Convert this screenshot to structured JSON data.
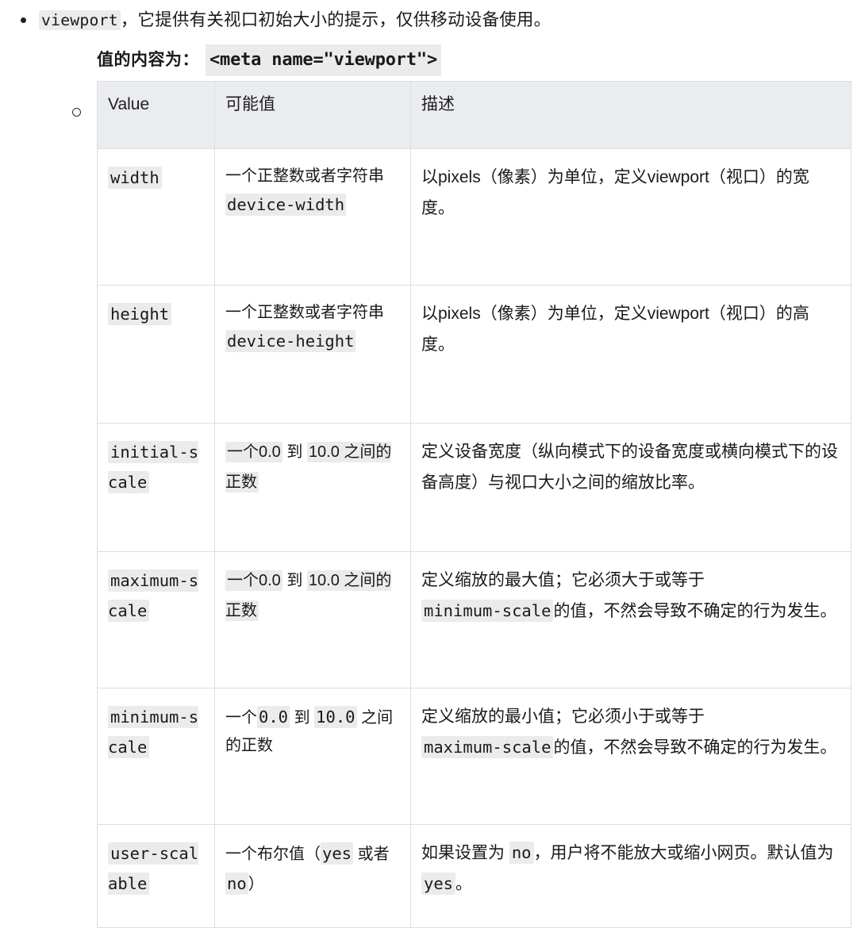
{
  "intro": {
    "bullet_code": "viewport",
    "bullet_text": "，它提供有关视口初始大小的提示，仅供移动设备使用。"
  },
  "value_line": {
    "label": "值的内容为：",
    "code": "<meta name=\"viewport\">"
  },
  "table": {
    "headers": [
      "Value",
      "可能值",
      "描述"
    ],
    "rows": [
      {
        "key": "width",
        "value_plain_1": "一个正整数或者字符串 ",
        "value_code_1": "device-width",
        "value_plain_2": "",
        "value_code_2": "",
        "value_plain_3": "",
        "desc_1": "以pixels（像素）为单位，定义viewport（视口）的宽度。",
        "desc_code": "",
        "desc_2": ""
      },
      {
        "key": "height",
        "value_plain_1": "一个正整数或者字符串 ",
        "value_code_1": "device-height",
        "value_plain_2": "",
        "value_code_2": "",
        "value_plain_3": "",
        "desc_1": "以pixels（像素）为单位，定义viewport（视口）的高度。",
        "desc_code": "",
        "desc_2": ""
      },
      {
        "key": "initial-scale",
        "value_plain_1": "",
        "value_code_1": "一个0.0",
        "value_plain_2": " 到 ",
        "value_code_2": "10.0 之间的正数",
        "value_plain_3": "",
        "desc_1": "定义设备宽度（纵向模式下的设备宽度或横向模式下的设备高度）与视口大小之间的缩放比率。",
        "desc_code": "",
        "desc_2": ""
      },
      {
        "key": "maximum-scale",
        "value_plain_1": "",
        "value_code_1": "一个0.0",
        "value_plain_2": " 到 ",
        "value_code_2": "10.0 之间的正数",
        "value_plain_3": "",
        "desc_1": "定义缩放的最大值；它必须大于或等于",
        "desc_code": "minimum-scale",
        "desc_2": "的值，不然会导致不确定的行为发生。"
      },
      {
        "key": "minimum-scale",
        "value_plain_1": "一个",
        "value_code_1": "0.0",
        "value_plain_2": " 到 ",
        "value_code_2": "10.0",
        "value_plain_3": " 之间的正数",
        "desc_1": "定义缩放的最小值；它必须小于或等于",
        "desc_code": "maximum-scale",
        "desc_2": "的值，不然会导致不确定的行为发生。"
      },
      {
        "key": "user-scalable",
        "value_plain_1": "一个布尔值（",
        "value_code_1": "yes",
        "value_plain_2": " 或者",
        "value_code_2": "no",
        "value_plain_3": "）",
        "desc_1": "如果设置为 ",
        "desc_code": "no",
        "desc_2": "，用户将不能放大或缩小网页。默认值为 ",
        "desc_code_2": "yes",
        "desc_3": "。"
      }
    ]
  },
  "colors": {
    "header_bg": "#eaecef",
    "code_bg": "#ebebeb",
    "border": "#dcdde1",
    "text": "#1a1a1a"
  }
}
